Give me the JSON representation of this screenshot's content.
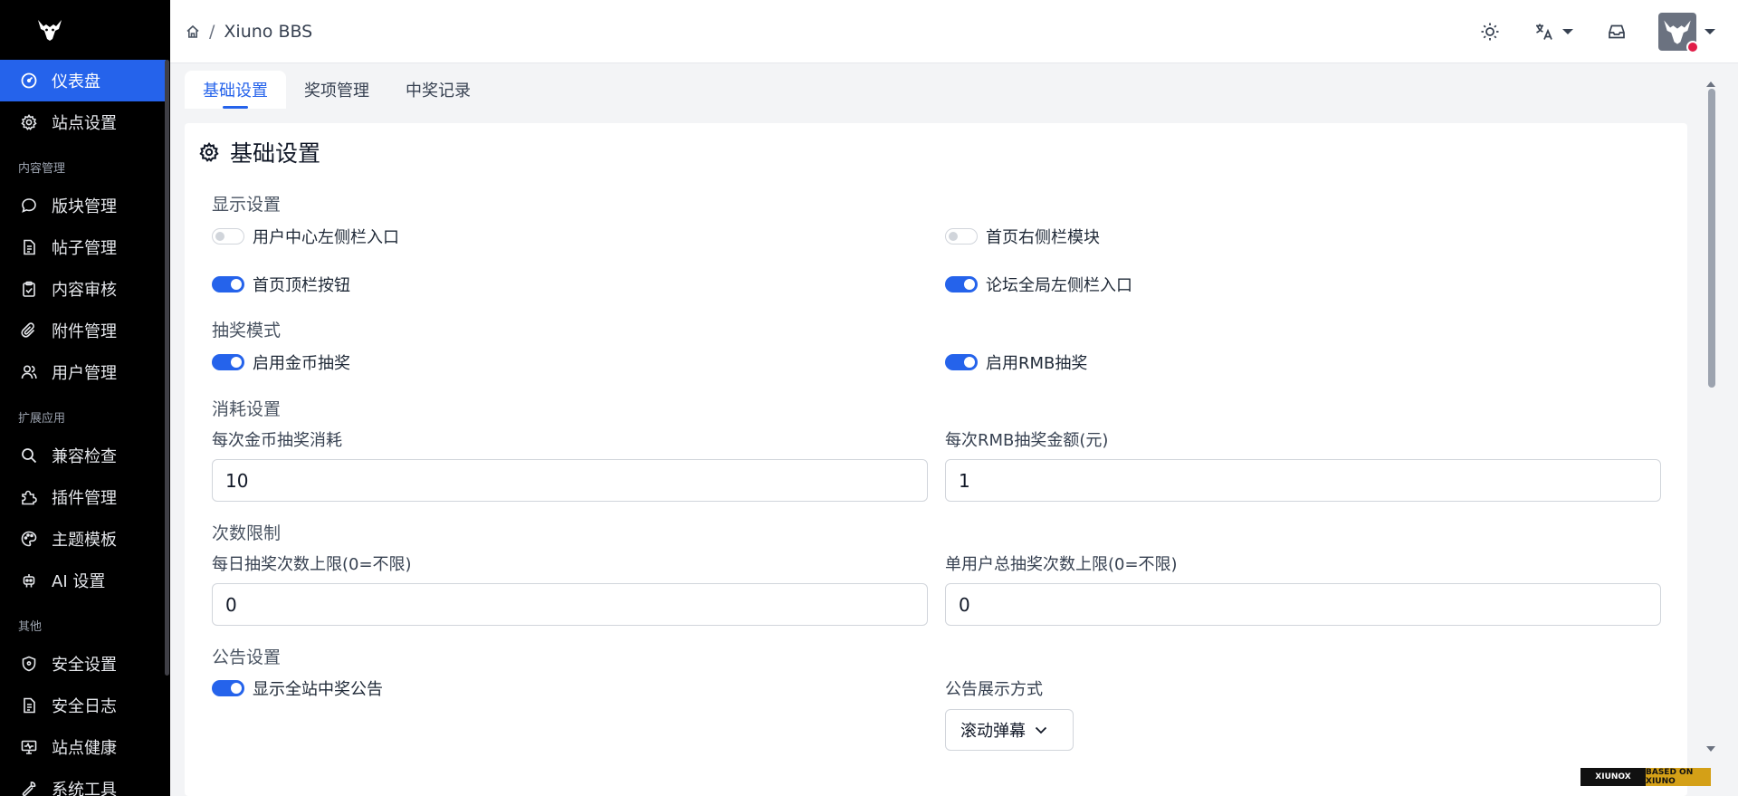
{
  "header": {
    "breadcrumb": "Xiuno BBS",
    "icons": [
      "home-icon",
      "sun-icon",
      "language-icon",
      "inbox-icon",
      "avatar",
      "chevron-down-icon"
    ]
  },
  "sidebar": {
    "items_top": [
      {
        "label": "仪表盘",
        "icon": "dashboard-icon",
        "active": true
      },
      {
        "label": "站点设置",
        "icon": "gear-icon"
      }
    ],
    "section_content": "内容管理",
    "items_content": [
      {
        "label": "版块管理",
        "icon": "chat-icon"
      },
      {
        "label": "帖子管理",
        "icon": "document-icon"
      },
      {
        "label": "内容审核",
        "icon": "clipboard-check-icon"
      },
      {
        "label": "附件管理",
        "icon": "paperclip-icon"
      },
      {
        "label": "用户管理",
        "icon": "users-icon"
      }
    ],
    "section_ext": "扩展应用",
    "items_ext": [
      {
        "label": "兼容检查",
        "icon": "search-icon"
      },
      {
        "label": "插件管理",
        "icon": "puzzle-icon"
      },
      {
        "label": "主题模板",
        "icon": "palette-icon"
      },
      {
        "label": "AI 设置",
        "icon": "robot-icon"
      }
    ],
    "section_other": "其他",
    "items_other": [
      {
        "label": "安全设置",
        "icon": "shield-icon"
      },
      {
        "label": "安全日志",
        "icon": "document-icon"
      },
      {
        "label": "站点健康",
        "icon": "monitor-icon"
      },
      {
        "label": "系统工具",
        "icon": "tool-icon"
      }
    ]
  },
  "tabs": [
    "基础设置",
    "奖项管理",
    "中奖记录"
  ],
  "card": {
    "title": "基础设置",
    "display": {
      "label": "显示设置",
      "user_center_sidebar": {
        "label": "用户中心左侧栏入口",
        "on": false
      },
      "home_right_sidebar": {
        "label": "首页右侧栏模块",
        "on": false
      },
      "home_top_button": {
        "label": "首页顶栏按钮",
        "on": true
      },
      "forum_left_sidebar": {
        "label": "论坛全局左侧栏入口",
        "on": true
      }
    },
    "mode": {
      "label": "抽奖模式",
      "gold": {
        "label": "启用金币抽奖",
        "on": true
      },
      "rmb": {
        "label": "启用RMB抽奖",
        "on": true
      }
    },
    "cost": {
      "label": "消耗设置",
      "gold_label": "每次金币抽奖消耗",
      "gold_value": "10",
      "rmb_label": "每次RMB抽奖金额(元)",
      "rmb_value": "1"
    },
    "limit": {
      "label": "次数限制",
      "daily_label": "每日抽奖次数上限(0=不限)",
      "daily_value": "0",
      "total_label": "单用户总抽奖次数上限(0=不限)",
      "total_value": "0"
    },
    "notice": {
      "label": "公告设置",
      "show": {
        "label": "显示全站中奖公告",
        "on": true
      },
      "mode_label": "公告展示方式",
      "mode_value": "滚动弹幕"
    }
  },
  "badge": {
    "left": "XIUNOX",
    "right": "BASED ON XIUNO"
  },
  "colors": {
    "accent": "#2563eb",
    "sidebar": "#000000"
  }
}
